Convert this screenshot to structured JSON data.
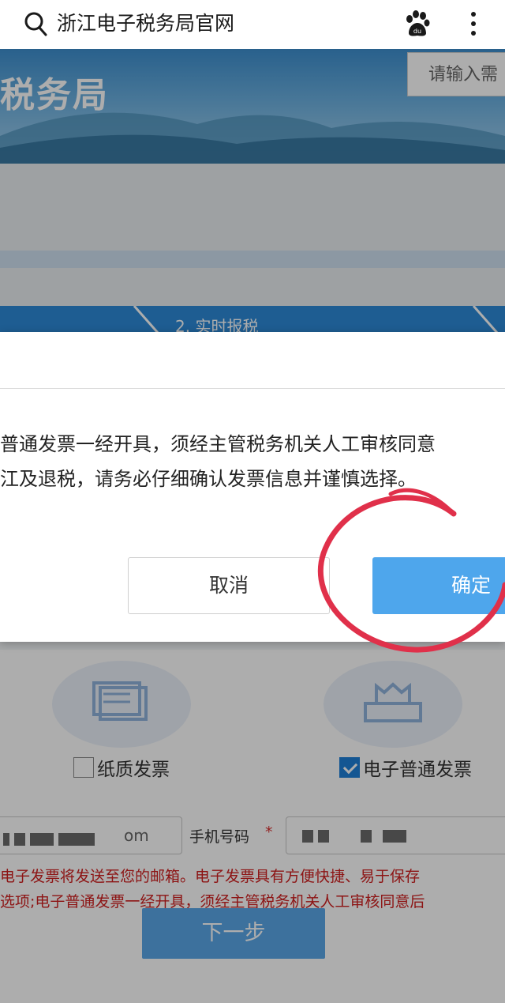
{
  "browser": {
    "title": "浙江电子税务局官网"
  },
  "page": {
    "banner_title": "税务局",
    "banner_search_placeholder": "请输入需",
    "step_label": "2. 实时报税",
    "paper_invoice_label": "纸质发票",
    "paper_invoice_checked": false,
    "e_invoice_label": "电子普通发票",
    "e_invoice_checked": true,
    "email_value_tail": "om",
    "phone_label": "手机号码",
    "phone_required_mark": "*",
    "notice_line1": "电子发票将发送至您的邮箱。电子发票具有方便快捷、易于保存",
    "notice_line2": "选项;电子普通发票一经开具，须经主管税务机关人工审核同意后",
    "next_button": "下一步"
  },
  "modal": {
    "message_line1": "普通发票一经开具，须经主管税务机关人工审核同意",
    "message_line2": "江及退税，请务必仔细确认发票信息并谨慎选择。",
    "cancel_label": "取消",
    "ok_label": "确定"
  },
  "colors": {
    "primary_blue": "#4ea6ec",
    "annotation_red": "#e0304a",
    "notice_red": "#d02020"
  },
  "icons": {
    "search": "search-icon",
    "baidu": "baidu-paw-icon",
    "more": "more-vertical-icon",
    "paper_invoice": "paper-invoice-icon",
    "e_invoice": "e-invoice-printer-icon"
  }
}
